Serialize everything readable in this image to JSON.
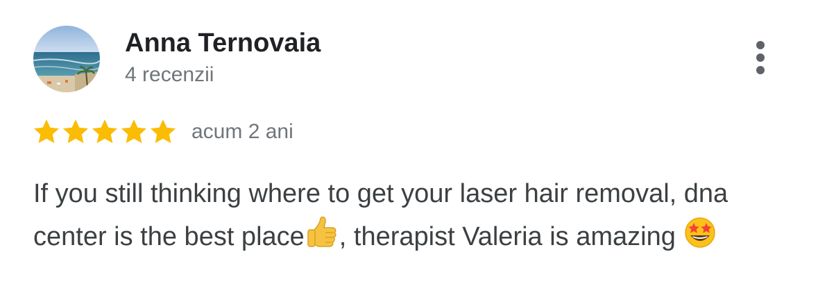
{
  "review": {
    "author_name": "Anna Ternovaia",
    "review_count": "4 recenzii",
    "rating": 5,
    "rating_max": 5,
    "date": "acum 2 ani",
    "text_part1": "If you still thinking where to get your laser hair removal, dna center is the best place",
    "text_part2": ", therapist Valeria is amazing ",
    "emojis": [
      "thumbs-up-icon",
      "star-struck-icon"
    ]
  },
  "colors": {
    "star": "#fbbc04",
    "name": "#202124",
    "secondary": "#70757a",
    "body": "#3c4043"
  },
  "icons": {
    "menu": "more-vert-icon"
  }
}
